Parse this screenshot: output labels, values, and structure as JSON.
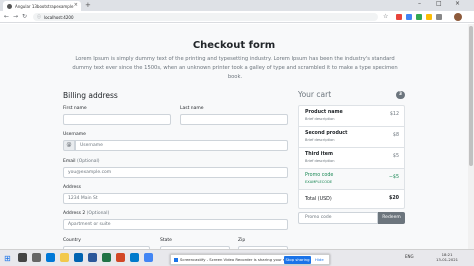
{
  "browser": {
    "tab_title": "Angular 13bootstrapexample",
    "tab_close": "×",
    "new_tab": "+",
    "url": "localhost:4200",
    "back": "←",
    "forward": "→",
    "reload": "↻",
    "info_icon": "ⓘ",
    "window_controls": [
      "–",
      "□",
      "×"
    ]
  },
  "page": {
    "title": "Checkout form",
    "lead": "Lorem Ipsum is simply dummy text of the printing and typesetting industry. Lorem Ipsum has been the industry's standard dummy text ever since the 1500s, when an unknown printer took a galley of type and scrambled it to make a type specimen book."
  },
  "billing": {
    "heading": "Billing address",
    "first_name_label": "First name",
    "last_name_label": "Last name",
    "username_label": "Username",
    "username_prefix": "@",
    "username_placeholder": "Username",
    "email_label": "Email",
    "email_optional": "(Optional)",
    "email_placeholder": "you@example.com",
    "address_label": "Address",
    "address_placeholder": "1234 Main St",
    "address2_label": "Address 2",
    "address2_optional": "(Optional)",
    "address2_placeholder": "Apartment or suite",
    "country_label": "Country",
    "state_label": "State",
    "zip_label": "Zip"
  },
  "cart": {
    "heading": "Your cart",
    "count": "3",
    "items": [
      {
        "name": "Product name",
        "desc": "Brief description",
        "price": "$12"
      },
      {
        "name": "Second product",
        "desc": "Brief description",
        "price": "$8"
      },
      {
        "name": "Third item",
        "desc": "Brief description",
        "price": "$5"
      },
      {
        "name": "Promo code",
        "desc": "EXAMPLECODE",
        "price": "−$5"
      },
      {
        "name": "Total (USD)",
        "desc": "",
        "price": "$20"
      }
    ],
    "promo_placeholder": "Promo code",
    "redeem_label": "Redeem"
  },
  "share_banner": {
    "text": "Screencastify - Screen Video Recorder is sharing your screen.",
    "stop_label": "Stop sharing",
    "hide_label": "Hide"
  },
  "taskbar": {
    "tray_lang": "ENG",
    "time": "18:21",
    "date": "13-01-2021"
  },
  "colors": {
    "secondary": "#6c757d",
    "success": "#198754",
    "share_blue": "#1a73e8"
  }
}
